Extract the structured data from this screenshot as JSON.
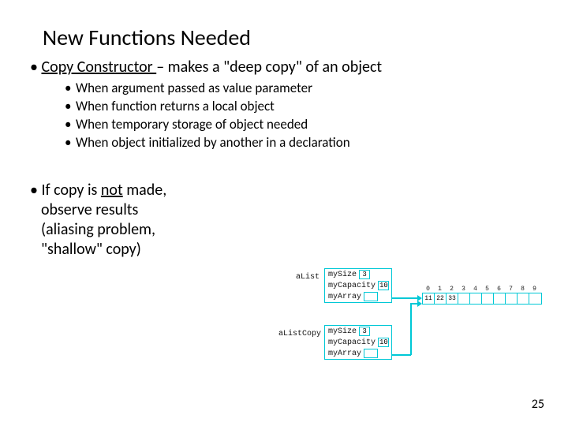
{
  "title": "New Functions Needed",
  "bullet1": {
    "prefix": "• ",
    "term": "Copy Constructor ",
    "dash": "– ",
    "rest": "makes a \"deep copy\" of an object"
  },
  "subitems": [
    "When argument passed as value parameter",
    "When function returns a local object",
    "When temporary storage of object needed",
    "When object initialized by another in a declaration"
  ],
  "bullet2": {
    "prefix": "• ",
    "l1a": "If copy is ",
    "not": "not",
    "l1b": " made,",
    "l2": "observe results",
    "l3": "(aliasing problem,",
    "l4": "\"shallow\" copy)"
  },
  "pagenum": "25",
  "diagram": {
    "obj1": {
      "label": "aList",
      "fields": {
        "size_name": "mySize",
        "size_val": "3",
        "cap_name": "myCapacity",
        "cap_val": "10",
        "arr_name": "myArray"
      }
    },
    "obj2": {
      "label": "aListCopy",
      "fields": {
        "size_name": "mySize",
        "size_val": "3",
        "cap_name": "myCapacity",
        "cap_val": "10",
        "arr_name": "myArray"
      }
    },
    "array": {
      "indices": [
        "0",
        "1",
        "2",
        "3",
        "4",
        "5",
        "6",
        "7",
        "8",
        "9"
      ],
      "cells": [
        "11",
        "22",
        "33",
        "",
        "",
        "",
        "",
        "",
        "",
        ""
      ]
    }
  }
}
